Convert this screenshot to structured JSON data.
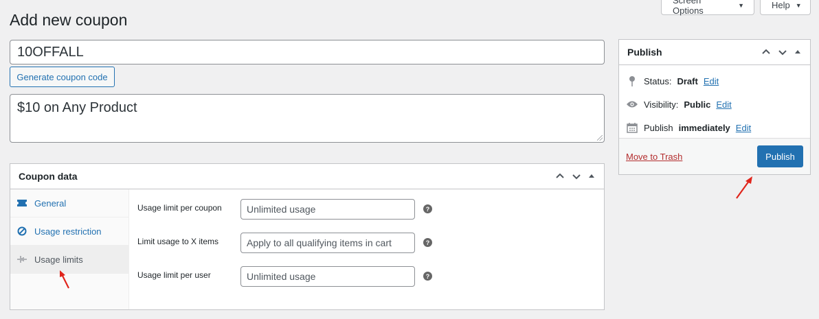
{
  "header": {
    "title": "Add new coupon",
    "screen_options_label": "Screen Options",
    "help_label": "Help"
  },
  "coupon": {
    "code": "10OFFALL",
    "generate_label": "Generate coupon code",
    "description": "$10 on Any Product"
  },
  "coupon_data": {
    "title": "Coupon data",
    "tabs": [
      {
        "label": "General",
        "icon": "ticket-icon"
      },
      {
        "label": "Usage restriction",
        "icon": "block-icon"
      },
      {
        "label": "Usage limits",
        "icon": "limits-icon",
        "active": true
      }
    ],
    "fields": [
      {
        "label": "Usage limit per coupon",
        "placeholder": "Unlimited usage"
      },
      {
        "label": "Limit usage to X items",
        "placeholder": "Apply to all qualifying items in cart"
      },
      {
        "label": "Usage limit per user",
        "placeholder": "Unlimited usage"
      }
    ],
    "help_glyph": "?"
  },
  "publish": {
    "title": "Publish",
    "status_label": "Status:",
    "status_value": "Draft",
    "visibility_label": "Visibility:",
    "visibility_value": "Public",
    "schedule_label": "Publish",
    "schedule_value": "immediately",
    "edit_label": "Edit",
    "trash_label": "Move to Trash",
    "publish_label": "Publish"
  },
  "colors": {
    "accent": "#2271b1",
    "danger": "#b32d2e",
    "annotation_arrow": "#e0241b"
  }
}
